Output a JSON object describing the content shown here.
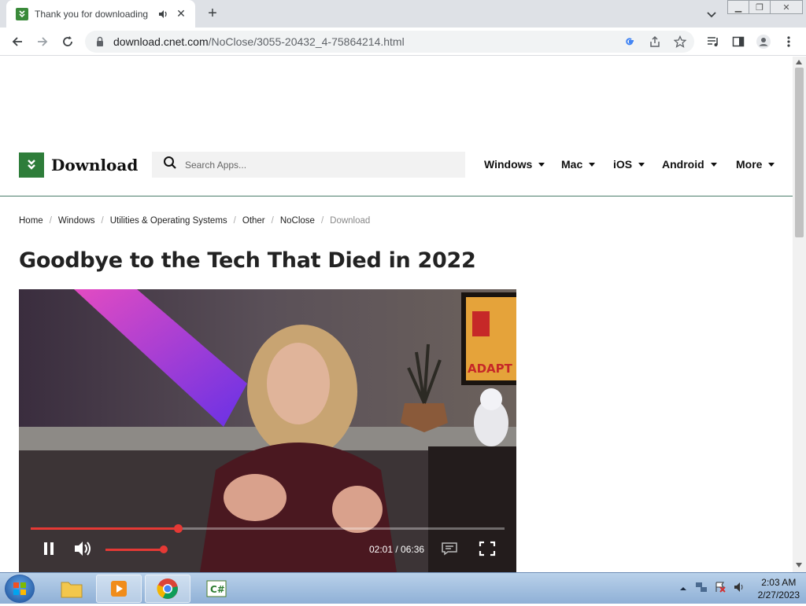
{
  "browser": {
    "tab_title": "Thank you for downloading",
    "tab_favicon": "download-favicon",
    "url_host": "download.cnet.com",
    "url_path": "/NoClose/3055-20432_4-75864214.html"
  },
  "site": {
    "logo_text": "Download",
    "search_placeholder": "Search Apps...",
    "nav": [
      {
        "label": "Windows"
      },
      {
        "label": "Mac"
      },
      {
        "label": "iOS"
      },
      {
        "label": "Android"
      },
      {
        "label": "More"
      }
    ]
  },
  "breadcrumb": [
    {
      "label": "Home"
    },
    {
      "label": "Windows"
    },
    {
      "label": "Utilities & Operating Systems"
    },
    {
      "label": "Other"
    },
    {
      "label": "NoClose"
    },
    {
      "label": "Download"
    }
  ],
  "article": {
    "headline": "Goodbye to the Tech That Died in 2022",
    "poster_sign": "ADAPT"
  },
  "video": {
    "elapsed": "02:01",
    "separator": " / ",
    "duration": "06:36",
    "progress_fraction": 0.31,
    "volume_fraction": 0.95,
    "accent_color": "#e53935"
  },
  "taskbar": {
    "apps": [
      {
        "name": "windows-explorer"
      },
      {
        "name": "media-player"
      },
      {
        "name": "chrome"
      },
      {
        "name": "csharp-app"
      }
    ],
    "time": "2:03 AM",
    "date": "2/27/2023"
  }
}
